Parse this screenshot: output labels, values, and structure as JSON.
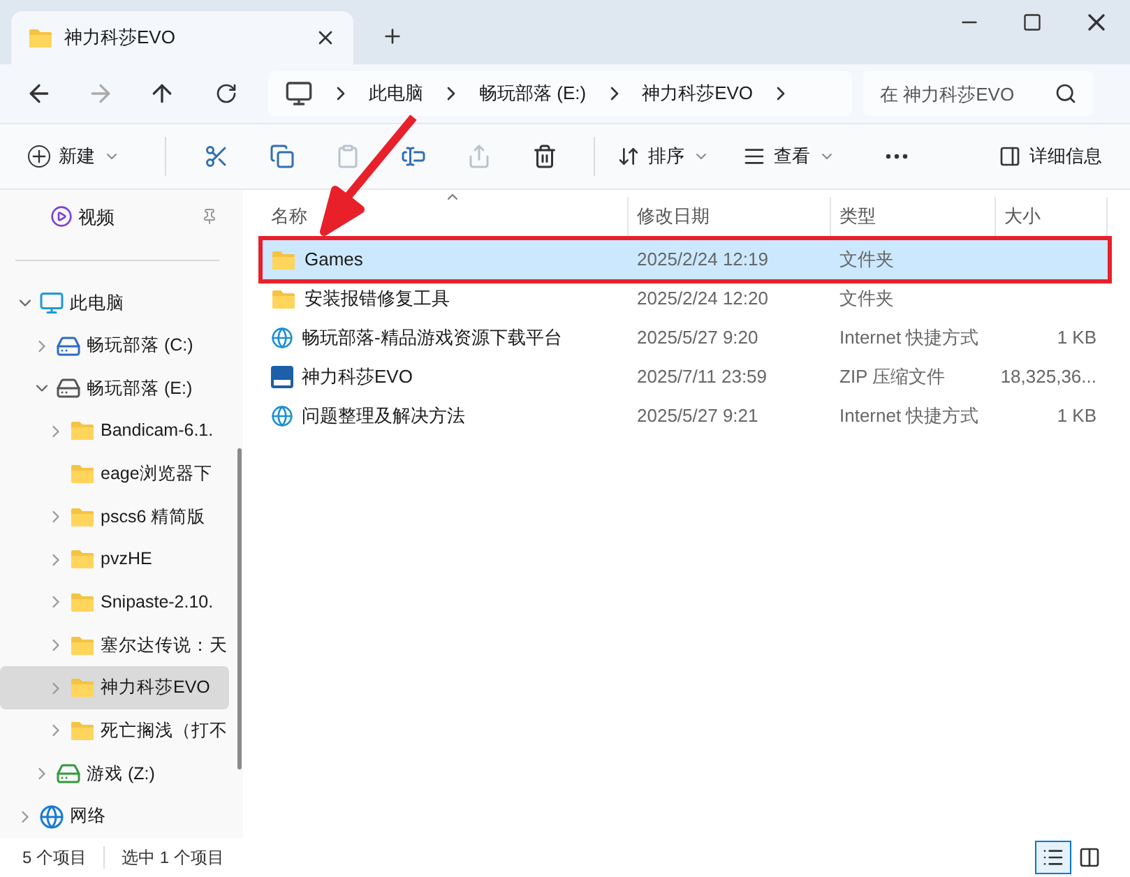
{
  "window": {
    "tab_title": "神力科莎EVO"
  },
  "navigation": {
    "back_disabled": false,
    "forward_disabled": true
  },
  "breadcrumb": [
    "此电脑",
    "畅玩部落 (E:)",
    "神力科莎EVO"
  ],
  "search": {
    "placeholder": "在 神力科莎EVO"
  },
  "toolbar": [
    {
      "kind": "new",
      "label": "新建"
    },
    {
      "kind": "cut",
      "disabled": false
    },
    {
      "kind": "copy",
      "disabled": false
    },
    {
      "kind": "paste",
      "disabled": true
    },
    {
      "kind": "rename",
      "disabled": false
    },
    {
      "kind": "share",
      "disabled": true
    },
    {
      "kind": "delete",
      "disabled": false
    },
    {
      "kind": "sort",
      "label": "排序"
    },
    {
      "kind": "view",
      "label": "查看"
    },
    {
      "kind": "more"
    }
  ],
  "details_button": "详细信息",
  "sidebar": {
    "pinned": [
      {
        "label": "视频",
        "kind": "video"
      }
    ],
    "tree": [
      {
        "label": "此电脑",
        "kind": "pc",
        "expanded": true,
        "selected": false,
        "children": [
          {
            "label": "畅玩部落 (C:)",
            "kind": "sysdrive",
            "expanded": false,
            "selected": false
          },
          {
            "label": "畅玩部落 (E:)",
            "kind": "drive",
            "expanded": true,
            "selected": false,
            "children": [
              {
                "label": "Bandicam-6.1.",
                "kind": "folder",
                "expanded": false,
                "selected": false
              },
              {
                "label": "eage浏览器下",
                "kind": "folder",
                "selected": false
              },
              {
                "label": "pscs6 精简版",
                "kind": "folder",
                "expanded": false,
                "selected": false
              },
              {
                "label": "pvzHE",
                "kind": "folder",
                "expanded": false,
                "selected": false
              },
              {
                "label": "Snipaste-2.10.",
                "kind": "folder",
                "expanded": false,
                "selected": false
              },
              {
                "label": "塞尔达传说：天",
                "kind": "folder",
                "expanded": false,
                "selected": false
              },
              {
                "label": "神力科莎EVO",
                "kind": "folder",
                "expanded": false,
                "selected": true
              },
              {
                "label": "死亡搁浅（打不",
                "kind": "folder",
                "expanded": false,
                "selected": false
              }
            ]
          },
          {
            "label": "游戏 (Z:)",
            "kind": "greendrive",
            "expanded": false,
            "selected": false
          }
        ]
      },
      {
        "label": "网络",
        "kind": "network",
        "expanded": false,
        "selected": false
      }
    ]
  },
  "table": {
    "columns": [
      "名称",
      "修改日期",
      "类型",
      "大小"
    ],
    "rows": [
      {
        "name": "Games",
        "date": "2025/2/24 12:19",
        "type": "文件夹",
        "kind": "folder",
        "selected": true,
        "callout": true
      },
      {
        "name": "安装报错修复工具",
        "date": "2025/2/24 12:20",
        "type": "文件夹",
        "kind": "folder",
        "selected": false,
        "callout": false
      },
      {
        "name": "畅玩部落-精品游戏资源下载平台",
        "date": "2025/5/27 9:20",
        "type": "Internet 快捷方式",
        "size": "1 KB",
        "kind": "link",
        "selected": false,
        "callout": false
      },
      {
        "name": "神力科莎EVO",
        "date": "2025/7/11 23:59",
        "type": "ZIP 压缩文件",
        "size": "18,325,36...",
        "kind": "zip",
        "selected": false,
        "callout": false
      },
      {
        "name": "问题整理及解决方法",
        "date": "2025/5/27 9:21",
        "type": "Internet 快捷方式",
        "size": "1 KB",
        "kind": "link",
        "selected": false,
        "callout": false
      }
    ]
  },
  "status_bar": {
    "count": "5 个项目",
    "selection": "选中 1 个项目",
    "views": [
      {
        "kind": "details",
        "selected": true
      },
      {
        "kind": "tiles",
        "selected": false
      }
    ]
  }
}
